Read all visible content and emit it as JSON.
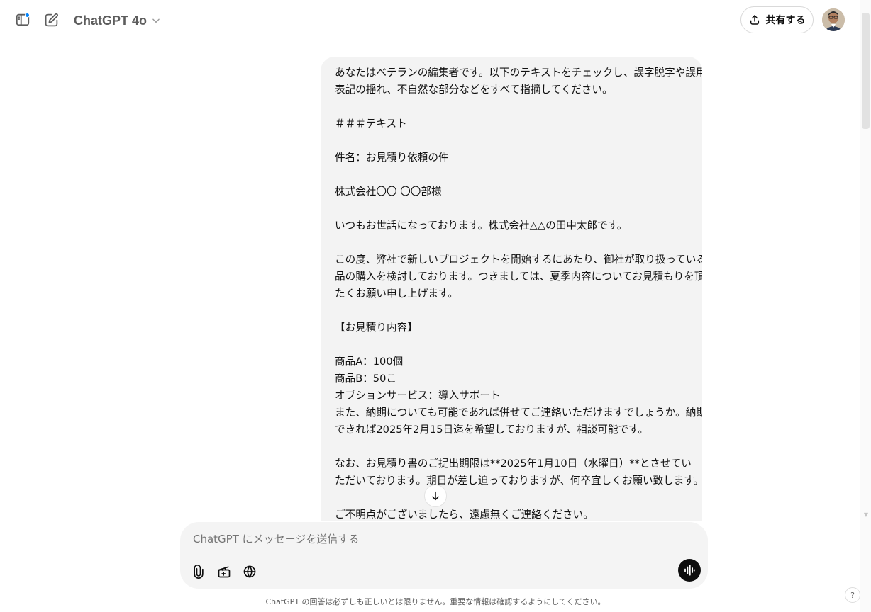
{
  "header": {
    "model_name": "ChatGPT 4o",
    "share_label": "共有する"
  },
  "message": {
    "lines": [
      "あなたはベテランの編集者です。以下のテキストをチェックし、誤字脱字や誤用、",
      "表記の揺れ、不自然な部分などをすべて指摘してください。",
      "",
      "＃＃＃テキスト",
      "",
      "件名：お見積り依頼の件",
      "",
      "株式会社〇〇 〇〇部様",
      "",
      "いつもお世話になっております。株式会社△△の田中太郎です。",
      "",
      "この度、弊社で新しいプロジェクトを開始するにあたり、御社が取り扱っている商",
      "品の購入を検討しております。つきましては、夏季内容についてお見積もりを頂き",
      "たくお願い申し上げます。",
      "",
      "【お見積り内容】",
      "",
      "商品A：100個",
      "商品B：50こ",
      "オプションサービス：導入サポート",
      "また、納期についても可能であれば併せてご連絡いただけますでしょうか。納期は",
      "できれば2025年2月15日迄を希望しておりますが、相談可能です。",
      "",
      "なお、お見積り書のご提出期限は**2025年1月10日（水曜日）**とさせてい",
      "ただいております。期日が差し迫っておりますが、何卒宜しくお願い致します。",
      "",
      "ご不明点がございましたら、遠慮無くご連絡ください。"
    ]
  },
  "composer": {
    "placeholder": "ChatGPT にメッセージを送信する"
  },
  "footer": {
    "disclaimer": "ChatGPT の回答は必ずしも正しいとは限りません。重要な情報は確認するようにしてください。",
    "help_label": "?"
  },
  "colors": {
    "accent_dot": "#0285ff",
    "bubble_bg": "#f3f3f3",
    "voice_btn": "#0d0d0d"
  }
}
